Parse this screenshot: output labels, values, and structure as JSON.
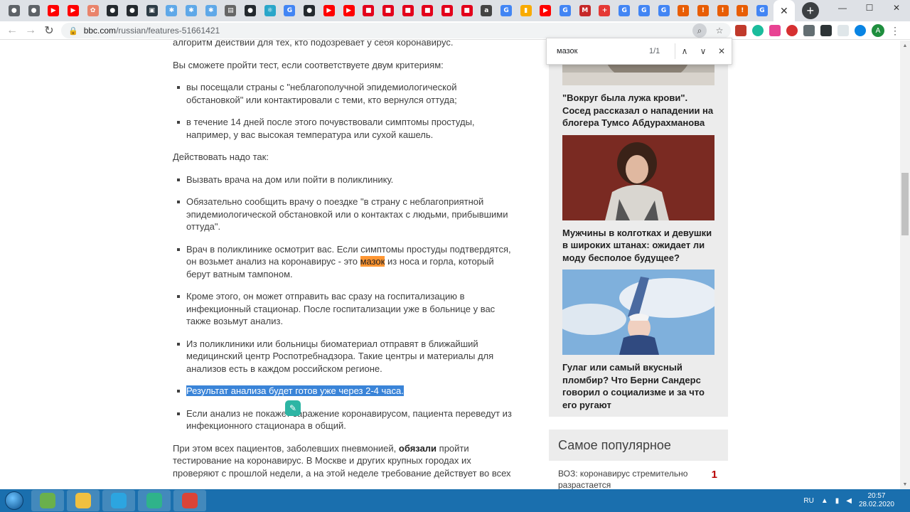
{
  "browser": {
    "tab_favicons": [
      {
        "icon": "chrome-gray-icon",
        "color": "#5f6368",
        "glyph": "●"
      },
      {
        "icon": "chrome-gray-icon",
        "color": "#5f6368",
        "glyph": "●"
      },
      {
        "icon": "youtube-icon",
        "color": "#ff0000",
        "glyph": "▶"
      },
      {
        "icon": "youtube-icon",
        "color": "#ff0000",
        "glyph": "▶"
      },
      {
        "icon": "pinterest-icon",
        "color": "#e9836b",
        "glyph": "✿"
      },
      {
        "icon": "github-icon",
        "color": "#24292e",
        "glyph": "●"
      },
      {
        "icon": "github-icon",
        "color": "#24292e",
        "glyph": "●"
      },
      {
        "icon": "terminal-icon",
        "color": "#2d3b45",
        "glyph": "▣"
      },
      {
        "icon": "star-icon",
        "color": "#5fa8e8",
        "glyph": "✱"
      },
      {
        "icon": "star-icon",
        "color": "#5fa8e8",
        "glyph": "✱"
      },
      {
        "icon": "star-icon",
        "color": "#5fa8e8",
        "glyph": "✱"
      },
      {
        "icon": "book-icon",
        "color": "#666666",
        "glyph": "▤"
      },
      {
        "icon": "github-icon",
        "color": "#24292e",
        "glyph": "●"
      },
      {
        "icon": "react-icon",
        "color": "#2aa6c9",
        "glyph": "⚛"
      },
      {
        "icon": "google-icon",
        "color": "#4285f4",
        "glyph": "G"
      },
      {
        "icon": "github-icon",
        "color": "#24292e",
        "glyph": "●"
      },
      {
        "icon": "youtube-icon",
        "color": "#ff0000",
        "glyph": "▶"
      },
      {
        "icon": "youtube-icon",
        "color": "#ff0000",
        "glyph": "▶"
      },
      {
        "icon": "shield-icon",
        "color": "#e3001b",
        "glyph": "■"
      },
      {
        "icon": "shield-icon",
        "color": "#e3001b",
        "glyph": "■"
      },
      {
        "icon": "shield-icon",
        "color": "#e3001b",
        "glyph": "■"
      },
      {
        "icon": "shield-icon",
        "color": "#e3001b",
        "glyph": "■"
      },
      {
        "icon": "shield-icon",
        "color": "#e3001b",
        "glyph": "■"
      },
      {
        "icon": "shield-icon",
        "color": "#e3001b",
        "glyph": "■"
      },
      {
        "icon": "ain-icon",
        "color": "#444444",
        "glyph": "a"
      },
      {
        "icon": "google-icon",
        "color": "#4285f4",
        "glyph": "G"
      },
      {
        "icon": "analytics-icon",
        "color": "#f9ab00",
        "glyph": "▮"
      },
      {
        "icon": "youtube-icon",
        "color": "#ff0000",
        "glyph": "▶"
      },
      {
        "icon": "google-icon",
        "color": "#4285f4",
        "glyph": "G"
      },
      {
        "icon": "mh-icon",
        "color": "#c62828",
        "glyph": "М"
      },
      {
        "icon": "plus-red-icon",
        "color": "#e53935",
        "glyph": "+"
      },
      {
        "icon": "google-icon",
        "color": "#4285f4",
        "glyph": "G"
      },
      {
        "icon": "google-icon",
        "color": "#4285f4",
        "glyph": "G"
      },
      {
        "icon": "google-icon",
        "color": "#4285f4",
        "glyph": "G"
      },
      {
        "icon": "alert-icon",
        "color": "#e85d04",
        "glyph": "!"
      },
      {
        "icon": "alert-icon",
        "color": "#e85d04",
        "glyph": "!"
      },
      {
        "icon": "alert-icon",
        "color": "#e85d04",
        "glyph": "!"
      },
      {
        "icon": "alert-icon",
        "color": "#e85d04",
        "glyph": "!"
      },
      {
        "icon": "google-icon",
        "color": "#4285f4",
        "glyph": "G"
      }
    ],
    "active_tab_close": "✕",
    "new_tab": "+",
    "window_controls": [
      "—",
      "☐",
      "✕"
    ],
    "url_host": "bbc.com",
    "url_path": "/russian/features-51661421",
    "avatar_letter": "A"
  },
  "find_bar": {
    "query": "мазок",
    "count": "1/1",
    "prev": "∧",
    "next": "∨",
    "close": "✕"
  },
  "article": {
    "p0": "алгоритм действий для тех, кто подозревает у себя коронавирус.",
    "p1": "Вы сможете пройти тест, если соответствуете двум критериям:",
    "criteria": [
      "вы посещали страны с \"неблагополучной эпидемиологической обстановкой\" или контактировали с теми, кто вернулся оттуда;",
      "в течение 14 дней после этого почувствовали симптомы простуды, например, у вас высокая температура или сухой кашель."
    ],
    "p2": "Действовать надо так:",
    "steps": {
      "s1": "Вызвать врача на дом или пойти в поликлинику.",
      "s2": "Обязательно сообщить врачу о поездке \"в страну с неблагоприятной эпидемиологической обстановкой или о контактах с людьми, прибывшими оттуда\".",
      "s3_before": "Врач в поликлинике осмотрит вас. Если симптомы простуды подтвердятся, он возьмет анализ на коронавирус - это ",
      "s3_match": "мазок",
      "s3_after": " из носа и горла, который берут ватным тампоном.",
      "s4": "Кроме этого, он может отправить вас сразу на госпитализацию в инфекционный стационар. После госпитализации уже в больнице у вас также возьмут анализ.",
      "s5": "Из поликлиники или больницы биоматериал отправят в ближайший медицинский центр Роспотребнадзора. Такие центры и материалы для анализов есть в каждом российском регионе.",
      "s6": "Результат анализа будет готов уже через 2-4 часа.",
      "s7": "Если анализ не покажет заражение коронавирусом, пациента переведут из инфекционного стационара в общий."
    },
    "p3_before": "При этом всех пациентов, заболевших пневмонией, ",
    "p3_bold": "обязали",
    "p3_after": " пройти тестирование на коронавирус. В Москве и других крупных городах их проверяют с прошлой недели, а на этой неделе требование действует во всех"
  },
  "sidebar": {
    "cards": [
      {
        "title": "\"Вокруг была лужа крови\". Сосед рассказал о нападении на блогера Тумсо Абдурахманова"
      },
      {
        "title": "Мужчины в колготках и девушки в широких штанах: ожидает ли моду бесполое будущее?"
      },
      {
        "title": "Гулаг или самый вкусный пломбир? Что Берни Сандерс говорил о социализме и за что его ругают"
      }
    ],
    "popular_heading": "Самое популярное",
    "popular_item": {
      "text": "ВОЗ: коронавирус стремительно разрастается",
      "rank": "1"
    }
  },
  "taskbar": {
    "apps": [
      {
        "icon": "gem-app-icon",
        "color": "#6ab04c"
      },
      {
        "icon": "folder-icon",
        "color": "#f0c040"
      },
      {
        "icon": "telegram-icon",
        "color": "#2ca5e0"
      },
      {
        "icon": "atom-icon",
        "color": "#2fb38a"
      },
      {
        "icon": "chrome-icon",
        "color": "#db4437"
      }
    ],
    "lang": "RU",
    "time": "20:57",
    "date": "28.02.2020"
  }
}
